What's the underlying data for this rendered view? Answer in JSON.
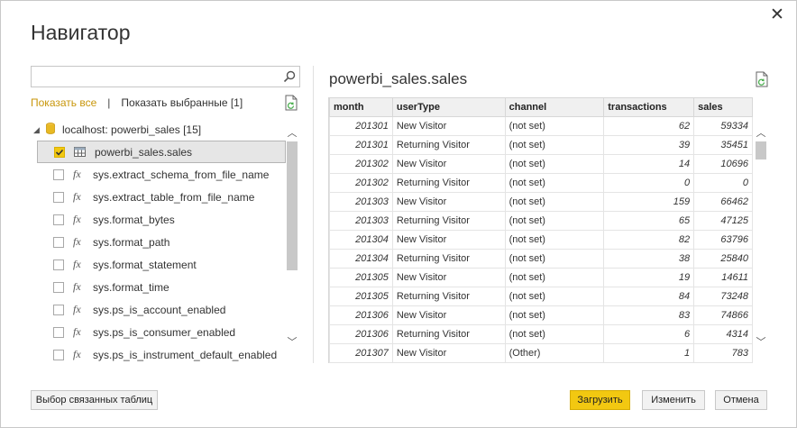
{
  "dialog": {
    "title": "Навигатор",
    "close_label": "✕"
  },
  "search": {
    "value": "",
    "placeholder": ""
  },
  "filters": {
    "show_all": "Показать все",
    "separator": "|",
    "show_selected": "Показать выбранные [1]"
  },
  "tree": {
    "root_label": "localhost: powerbi_sales [15]",
    "items": [
      {
        "label": "powerbi_sales.sales",
        "kind": "table",
        "checked": true
      },
      {
        "label": "sys.extract_schema_from_file_name",
        "kind": "function",
        "checked": false
      },
      {
        "label": "sys.extract_table_from_file_name",
        "kind": "function",
        "checked": false
      },
      {
        "label": "sys.format_bytes",
        "kind": "function",
        "checked": false
      },
      {
        "label": "sys.format_path",
        "kind": "function",
        "checked": false
      },
      {
        "label": "sys.format_statement",
        "kind": "function",
        "checked": false
      },
      {
        "label": "sys.format_time",
        "kind": "function",
        "checked": false
      },
      {
        "label": "sys.ps_is_account_enabled",
        "kind": "function",
        "checked": false
      },
      {
        "label": "sys.ps_is_consumer_enabled",
        "kind": "function",
        "checked": false
      },
      {
        "label": "sys.ps_is_instrument_default_enabled",
        "kind": "function",
        "checked": false
      }
    ],
    "fx_glyph": "fx",
    "scroll_position": 0.0,
    "scroll_visible_fraction": 0.65
  },
  "preview": {
    "title": "powerbi_sales.sales",
    "columns": [
      "month",
      "userType",
      "channel",
      "transactions",
      "sales"
    ],
    "rows": [
      [
        "201301",
        "New Visitor",
        "(not set)",
        "62",
        "59334"
      ],
      [
        "201301",
        "Returning Visitor",
        "(not set)",
        "39",
        "35451"
      ],
      [
        "201302",
        "New Visitor",
        "(not set)",
        "14",
        "10696"
      ],
      [
        "201302",
        "Returning Visitor",
        "(not set)",
        "0",
        "0"
      ],
      [
        "201303",
        "New Visitor",
        "(not set)",
        "159",
        "66462"
      ],
      [
        "201303",
        "Returning Visitor",
        "(not set)",
        "65",
        "47125"
      ],
      [
        "201304",
        "New Visitor",
        "(not set)",
        "82",
        "63796"
      ],
      [
        "201304",
        "Returning Visitor",
        "(not set)",
        "38",
        "25840"
      ],
      [
        "201305",
        "New Visitor",
        "(not set)",
        "19",
        "14611"
      ],
      [
        "201305",
        "Returning Visitor",
        "(not set)",
        "84",
        "73248"
      ],
      [
        "201306",
        "New Visitor",
        "(not set)",
        "83",
        "74866"
      ],
      [
        "201306",
        "Returning Visitor",
        "(not set)",
        "6",
        "4314"
      ],
      [
        "201307",
        "New Visitor",
        "(Other)",
        "1",
        "783"
      ]
    ],
    "numeric_columns": [
      0,
      3,
      4
    ],
    "scroll_position": 0.0,
    "scroll_visible_fraction": 0.08
  },
  "footer": {
    "related_tables": "Выбор связанных таблиц",
    "load": "Загрузить",
    "edit": "Изменить",
    "cancel": "Отмена"
  },
  "colors": {
    "accent": "#f2c811",
    "link_active": "#c8960a",
    "db_icon": "#e8b923",
    "refresh_icon": "#4caf50"
  }
}
